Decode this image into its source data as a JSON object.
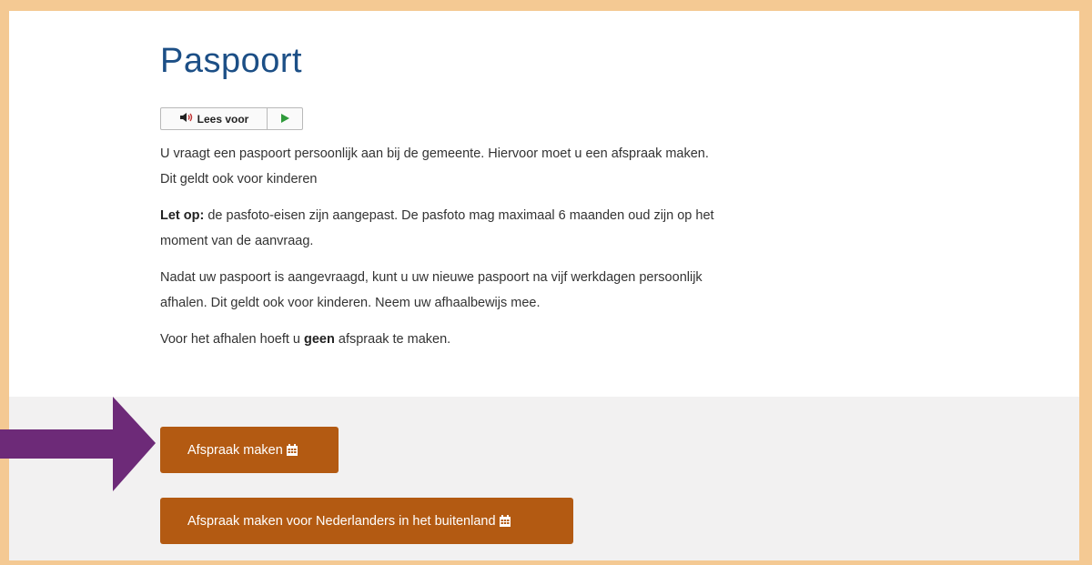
{
  "page": {
    "title": "Paspoort"
  },
  "readspeaker": {
    "listen_label": "Lees voor",
    "speaker_icon": "speaker-icon",
    "play_icon": "play-icon"
  },
  "content": {
    "p1": "U vraagt een paspoort persoonlijk aan bij de gemeente. Hiervoor moet u een afspraak maken. Dit geldt ook voor kinderen",
    "p2_bold": "Let op:",
    "p2_rest": " de pasfoto-eisen zijn aangepast. De pasfoto mag maximaal 6 maanden oud zijn op het moment van de aanvraag.",
    "p3": "Nadat uw paspoort is aangevraagd, kunt u uw nieuwe paspoort na vijf werkdagen persoonlijk afhalen. Dit geldt ook voor kinderen. Neem uw afhaalbewijs mee.",
    "p4_before": "Voor het afhalen hoeft u ",
    "p4_bold": "geen",
    "p4_after": " afspraak te maken."
  },
  "actions": {
    "appointment_label": "Afspraak maken",
    "appointment_abroad_label": "Afspraak maken voor Nederlanders in het buitenland",
    "icon": "calendar-icon"
  },
  "colors": {
    "frame_border": "#f4c993",
    "title": "#1c4f86",
    "button": "#b35a12",
    "arrow": "#6d2a78",
    "band": "#f2f1f1"
  }
}
